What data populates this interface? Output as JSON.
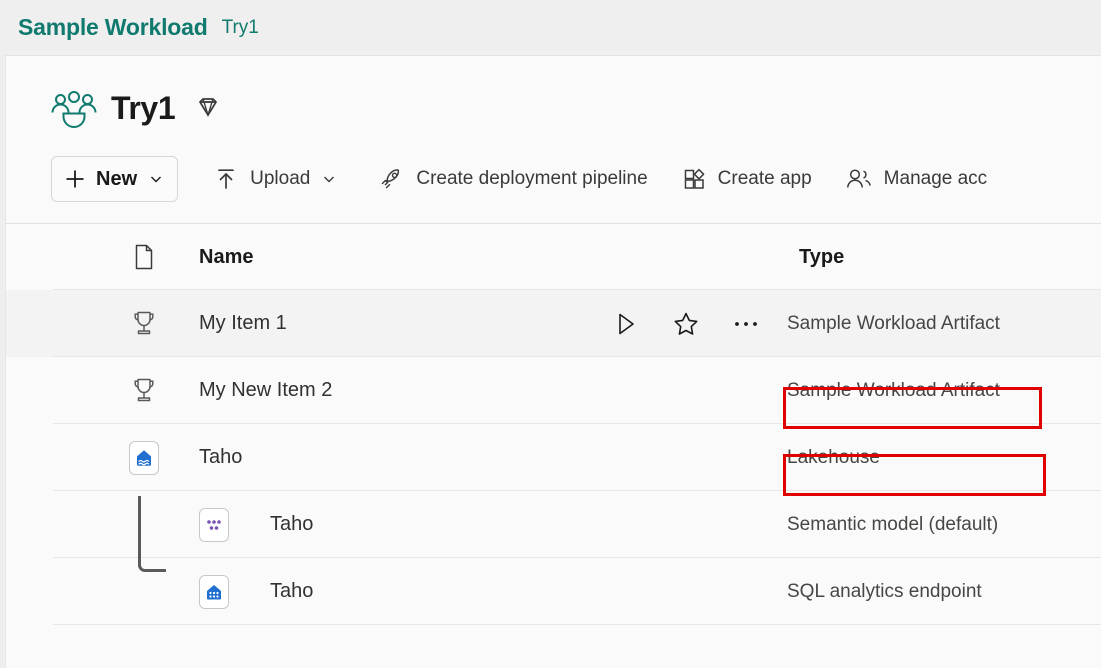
{
  "topbar": {
    "brand": "Sample Workload",
    "breadcrumb": "Try1",
    "brand_color": "#107a6e"
  },
  "workspace": {
    "name": "Try1",
    "icon": "workspace-people-icon",
    "badge_icon": "premium-diamond-icon"
  },
  "toolbar": {
    "new_label": "New",
    "upload_label": "Upload",
    "pipeline_label": "Create deployment pipeline",
    "create_app_label": "Create app",
    "manage_access_label": "Manage acc"
  },
  "table": {
    "columns": {
      "icon": "document-icon",
      "name": "Name",
      "type": "Type"
    },
    "rows": [
      {
        "icon": "trophy-icon",
        "name": "My Item 1",
        "type": "Sample Workload Artifact",
        "indented": false,
        "hovered": true,
        "annotated": true
      },
      {
        "icon": "trophy-icon",
        "name": "My New Item 2",
        "type": "Sample Workload Artifact",
        "indented": false,
        "hovered": false,
        "annotated": true
      },
      {
        "icon": "lakehouse-icon",
        "name": "Taho",
        "type": "Lakehouse",
        "indented": false,
        "hovered": false,
        "annotated": false
      },
      {
        "icon": "semantic-model-icon",
        "name": "Taho",
        "type": "Semantic model (default)",
        "indented": true,
        "hovered": false,
        "annotated": false
      },
      {
        "icon": "sql-endpoint-icon",
        "name": "Taho",
        "type": "SQL analytics endpoint",
        "indented": true,
        "hovered": false,
        "annotated": false
      }
    ]
  },
  "row_actions": {
    "run": "run-icon",
    "favorite": "star-icon",
    "more": "more-options-icon"
  },
  "annotation": {
    "color": "#e00000",
    "count": 2
  }
}
